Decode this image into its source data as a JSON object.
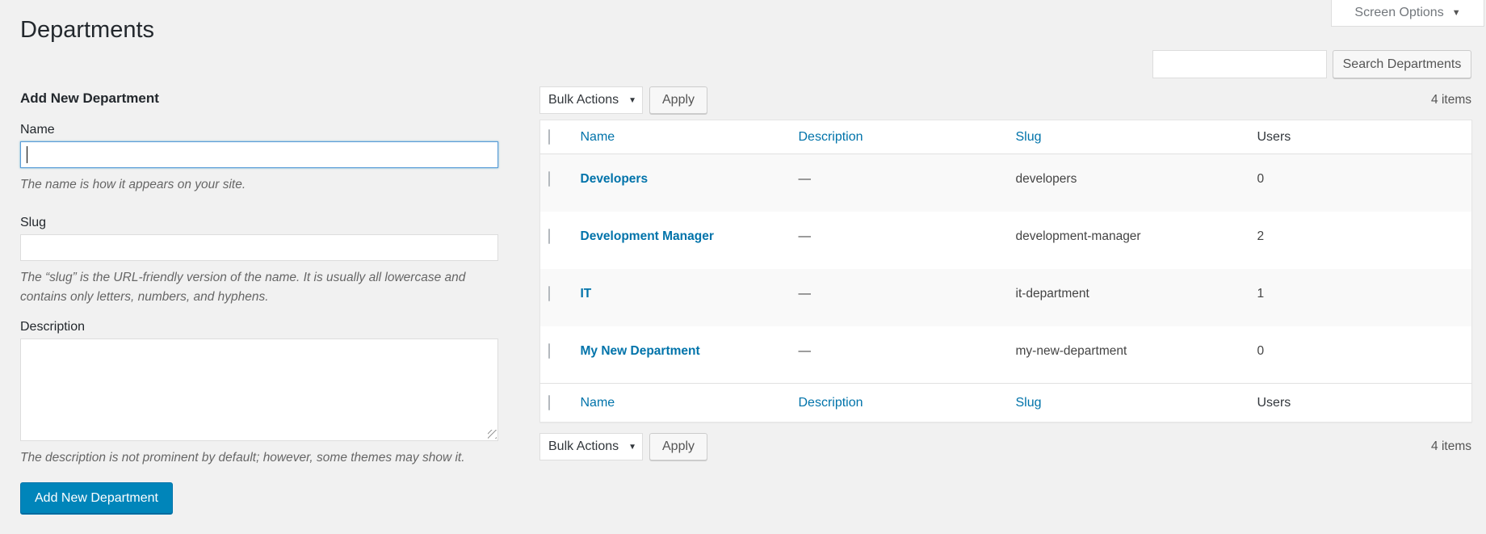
{
  "page": {
    "title": "Departments",
    "screen_options_label": "Screen Options"
  },
  "search": {
    "input_value": "",
    "button_label": "Search Departments"
  },
  "form": {
    "heading": "Add New Department",
    "name": {
      "label": "Name",
      "value": "",
      "help": "The name is how it appears on your site."
    },
    "slug": {
      "label": "Slug",
      "value": "",
      "help": "The “slug” is the URL-friendly version of the name. It is usually all lowercase and contains only letters, numbers, and hyphens."
    },
    "description": {
      "label": "Description",
      "value": "",
      "help": "The description is not prominent by default; however, some themes may show it."
    },
    "submit_label": "Add New Department"
  },
  "table": {
    "bulk_actions_label": "Bulk Actions",
    "apply_label": "Apply",
    "items_count": "4 items",
    "columns": [
      "Name",
      "Description",
      "Slug",
      "Users"
    ],
    "rows": [
      {
        "name": "Developers",
        "description": "—",
        "slug": "developers",
        "users": "0"
      },
      {
        "name": "Development Manager",
        "description": "—",
        "slug": "development-manager",
        "users": "2"
      },
      {
        "name": "IT",
        "description": "—",
        "slug": "it-department",
        "users": "1"
      },
      {
        "name": "My New Department",
        "description": "—",
        "slug": "my-new-department",
        "users": "0"
      }
    ]
  },
  "colors": {
    "link": "#0073aa",
    "primary_button": "#0085ba",
    "accent_focus": "#5b9dd9",
    "page_background": "#f1f1f1"
  }
}
